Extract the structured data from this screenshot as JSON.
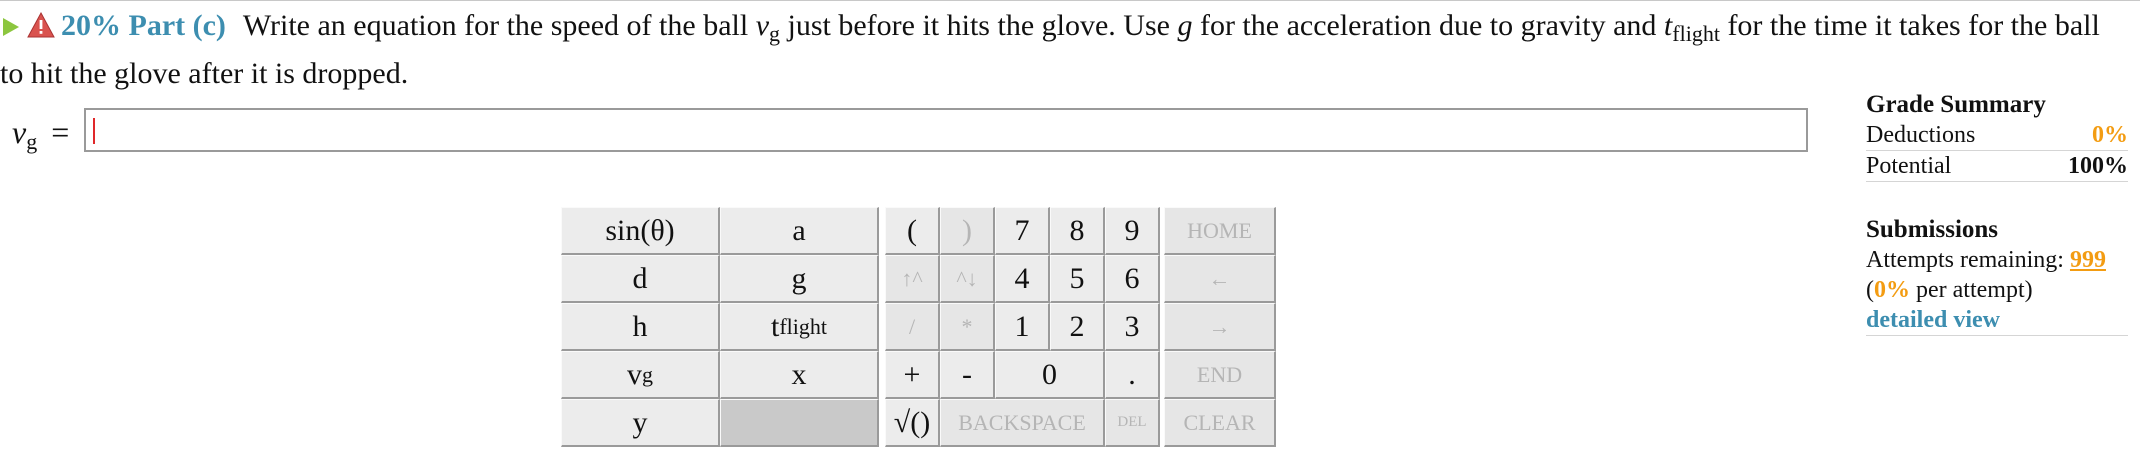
{
  "question": {
    "percent": "20%",
    "part": "Part (c)",
    "text_1": "Write an equation for the speed of the ball",
    "var_v": "v",
    "var_v_sub": "g",
    "text_2": "just before it hits the glove. Use",
    "var_g": "g",
    "text_3": "for the acceleration due to gravity and",
    "var_t": "t",
    "var_t_sub": "flight",
    "text_4": "for the time it takes for the ball to hit the glove after it is dropped."
  },
  "answer": {
    "label_var": "v",
    "label_sub": "g",
    "equals": "=",
    "value": ""
  },
  "keypad": {
    "vars": {
      "sin": "sin(θ)",
      "a": "a",
      "d": "d",
      "g": "g",
      "h": "h",
      "t": "t",
      "t_sub": "flight",
      "v": "v",
      "v_sub": "g",
      "x": "x",
      "y": "y"
    },
    "ops": {
      "lparen": "(",
      "rparen": ")",
      "pow_up": "↑^",
      "pow_down": "^↓",
      "div": "/",
      "mul": "*",
      "plus": "+",
      "minus": "-",
      "sqrt": "√()",
      "backspace": "BACKSPACE",
      "del": "DEL",
      "home": "HOME",
      "left": "←",
      "right": "→",
      "end": "END",
      "clear": "CLEAR",
      "dot": "."
    },
    "digits": {
      "d7": "7",
      "d8": "8",
      "d9": "9",
      "d4": "4",
      "d5": "5",
      "d6": "6",
      "d1": "1",
      "d2": "2",
      "d3": "3",
      "d0": "0"
    }
  },
  "panel": {
    "grade_title": "Grade Summary",
    "deductions_label": "Deductions",
    "deductions_value": "0%",
    "potential_label": "Potential",
    "potential_value": "100%",
    "submissions_title": "Submissions",
    "attempts_label": "Attempts remaining:",
    "attempts_value": "999",
    "per_attempt_open": "(",
    "per_attempt_value": "0%",
    "per_attempt_text": "per attempt)",
    "detailed_view": "detailed view"
  },
  "colors": {
    "accent": "#3d8eb0",
    "orange": "#f39c12",
    "play_green": "#8cc63f",
    "warn_red": "#d9534f"
  }
}
